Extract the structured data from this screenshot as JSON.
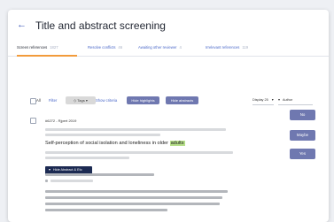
{
  "header": {
    "back_icon": "arrow-left-icon",
    "back_glyph": "←",
    "title": "Title and abstract screening"
  },
  "tabs": [
    {
      "label": "Screen references",
      "count": "1827",
      "active": true
    },
    {
      "label": "Resolve conflicts",
      "count": "46",
      "active": false
    },
    {
      "label": "Awaiting other reviewer",
      "count": "4",
      "active": false
    },
    {
      "label": "Irrelevant references",
      "count": "119",
      "active": false
    }
  ],
  "toolbar": {
    "all_label": "All",
    "filter_label": "Filter",
    "tags_label": "Tags",
    "tags_icon": "tag-icon",
    "tags_glyph": "◇",
    "tags_caret": "▾",
    "show_criteria_label": "Show criteria",
    "hide_highlights_label": "Hide highlights",
    "hide_abstracts_label": "Hide abstracts",
    "display_value": "Display 25",
    "sort_value": "Author",
    "select_caret": "▾"
  },
  "reference": {
    "id_text": "#6272 - Rjpert 2019",
    "title_text": "Self-perception of social isolation and loneliness in older",
    "title_highlight": "adults",
    "toggle_label": "Hide Abstract & Etc",
    "toggle_icon": "caret-down-icon",
    "toggle_glyph": "▾"
  },
  "decision": {
    "no_label": "No",
    "maybe_label": "Maybe",
    "yes_label": "Yes"
  },
  "colors": {
    "accent_tab": "#f29b3b",
    "button_primary": "#6f78b0",
    "button_dark": "#1c2a52",
    "highlight": "#b7e08a",
    "link": "#4a68c9"
  }
}
